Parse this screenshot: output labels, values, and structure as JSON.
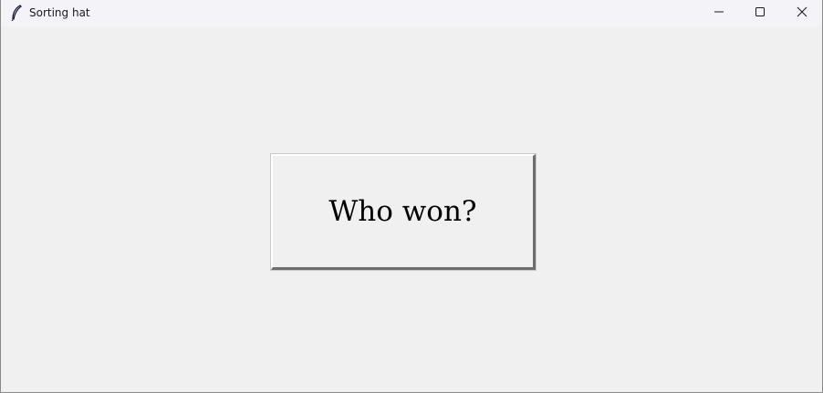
{
  "window": {
    "title": "Sorting hat",
    "icon": "feather-icon",
    "controls": [
      "minimize-icon",
      "maximize-icon",
      "close-icon"
    ]
  },
  "main": {
    "button_label": "Who won?"
  },
  "colors": {
    "background": "#f0f0f0",
    "titlebar": "#f3f3f8",
    "text": "#000000"
  }
}
